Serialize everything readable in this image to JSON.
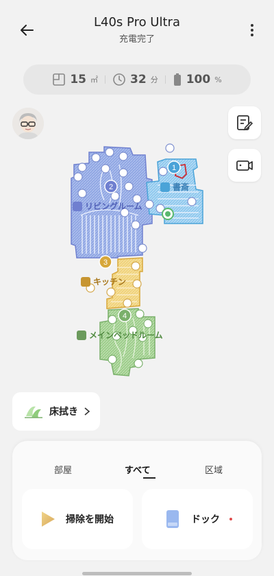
{
  "header": {
    "title": "L40s Pro Ultra",
    "subtitle": "充電完了"
  },
  "stats": {
    "area": {
      "value": "15",
      "unit": "㎡"
    },
    "time": {
      "value": "32",
      "unit": "分"
    },
    "battery": {
      "value": "100",
      "unit": "%"
    }
  },
  "map": {
    "rooms": [
      {
        "number": "1",
        "name": "書斎",
        "color": "#4aa3d8"
      },
      {
        "number": "2",
        "name": "リビングルーム",
        "color": "#6f7fd0"
      },
      {
        "number": "3",
        "name": "キッチン",
        "color": "#d7a73a"
      },
      {
        "number": "4",
        "name": "メインベッドルーム",
        "color": "#7ab06b"
      }
    ]
  },
  "mop_button": {
    "label": "床拭き"
  },
  "tabs": [
    {
      "label": "部屋"
    },
    {
      "label": "すべて"
    },
    {
      "label": "区域"
    }
  ],
  "actions": {
    "start": {
      "label": "掃除を開始"
    },
    "dock": {
      "label": "ドック"
    }
  },
  "colors": {
    "accent_red": "#e04a4a",
    "living": "#6f7fd0",
    "study": "#4aa3d8",
    "kitchen": "#d7a73a",
    "bedroom": "#7ab06b"
  }
}
